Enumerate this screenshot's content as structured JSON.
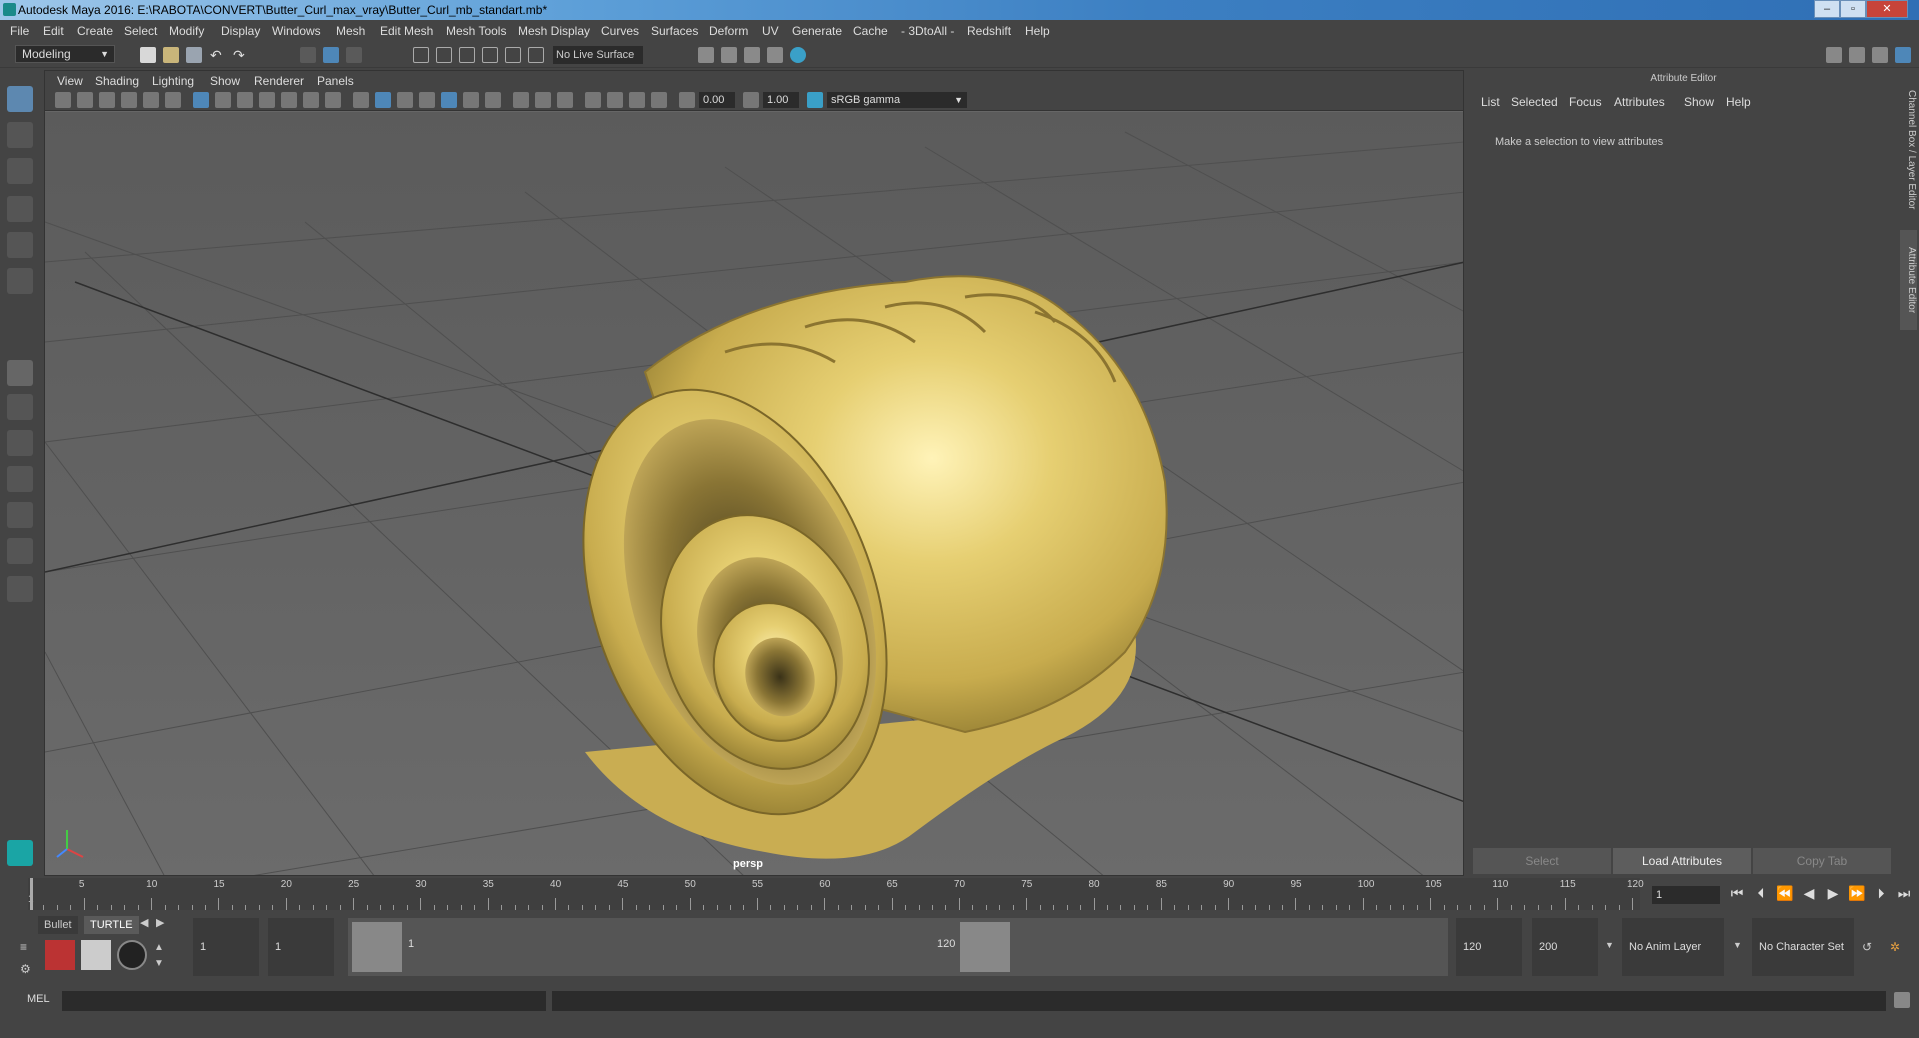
{
  "window": {
    "title": "Autodesk Maya 2016: E:\\RABOTA\\CONVERT\\Butter_Curl_max_vray\\Butter_Curl_mb_standart.mb*",
    "controls": [
      "–",
      "▫",
      "✕"
    ]
  },
  "menubar": [
    "File",
    "Edit",
    "Create",
    "Select",
    "Modify",
    "Display",
    "Windows",
    "Mesh",
    "Edit Mesh",
    "Mesh Tools",
    "Mesh Display",
    "Curves",
    "Surfaces",
    "Deform",
    "UV",
    "Generate",
    "Cache",
    "- 3DtoAll -",
    "Redshift",
    "Help"
  ],
  "status_line": {
    "mode": "Modeling",
    "live_surface": "No Live Surface"
  },
  "viewport": {
    "menu": [
      "View",
      "Shading",
      "Lighting",
      "Show",
      "Renderer",
      "Panels"
    ],
    "exposure": "0.00",
    "gamma": "1.00",
    "color_space": "sRGB gamma",
    "camera_label": "persp",
    "object_color": "#d9c36a"
  },
  "attribute_editor": {
    "header": "Attribute Editor",
    "menu": [
      "List",
      "Selected",
      "Focus",
      "Attributes",
      "Show",
      "Help"
    ],
    "message": "Make a selection to view attributes",
    "buttons": [
      "Select",
      "Load Attributes",
      "Copy Tab"
    ]
  },
  "side_tabs": [
    "Channel Box / Layer Editor",
    "Attribute Editor"
  ],
  "timeline": {
    "ticks": [
      "1",
      "5",
      "10",
      "15",
      "20",
      "25",
      "30",
      "35",
      "40",
      "45",
      "50",
      "55",
      "60",
      "65",
      "70",
      "75",
      "80",
      "85",
      "90",
      "95",
      "100",
      "105",
      "110",
      "115",
      "120"
    ],
    "current_frame": "1"
  },
  "range": {
    "shelf_tabs": [
      "Bullet",
      "TURTLE"
    ],
    "start_frame": "1",
    "playback_start": "1",
    "slider_start": "1",
    "slider_end": "120",
    "playback_end": "120",
    "end_frame": "200",
    "anim_layer": "No Anim Layer",
    "character_set": "No Character Set"
  },
  "command_line": {
    "label": "MEL"
  }
}
